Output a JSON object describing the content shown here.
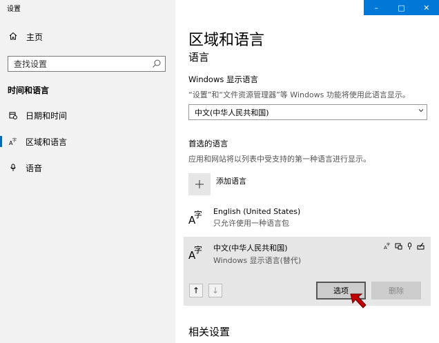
{
  "window": {
    "title": "设置",
    "controls": {
      "minimize": "–",
      "maximize": "□",
      "close": "✕"
    }
  },
  "sidebar": {
    "home": {
      "label": "主页",
      "icon": "home-icon"
    },
    "search": {
      "placeholder": "查找设置",
      "icon": "search-icon"
    },
    "section_title": "时间和语言",
    "items": [
      {
        "label": "日期和时间",
        "icon": "calendar-clock-icon",
        "active": false
      },
      {
        "label": "区域和语言",
        "icon": "language-icon",
        "active": true
      },
      {
        "label": "语音",
        "icon": "microphone-icon",
        "active": false
      }
    ]
  },
  "main": {
    "title": "区域和语言",
    "subtitle": "语言",
    "display_language": {
      "label": "Windows 显示语言",
      "description": "“设置”和“文件资源管理器”等 Windows 功能将使用此语言显示。",
      "selected": "中文(中华人民共和国)"
    },
    "preferred": {
      "label": "首选的语言",
      "description": "应用和网站将以列表中受支持的第一种语言进行显示。",
      "add_label": "添加语言",
      "languages": [
        {
          "name": "English (United States)",
          "detail": "只允许使用一种语言包"
        },
        {
          "name": "中文(中华人民共和国)",
          "detail": "Windows 显示语言(替代)"
        }
      ],
      "lang_glyph_a": "A",
      "lang_glyph_z": "字",
      "options_label": "选项",
      "remove_label": "删除",
      "up_arrow": "↑",
      "down_arrow": "↓"
    },
    "related_settings": "相关设置"
  }
}
